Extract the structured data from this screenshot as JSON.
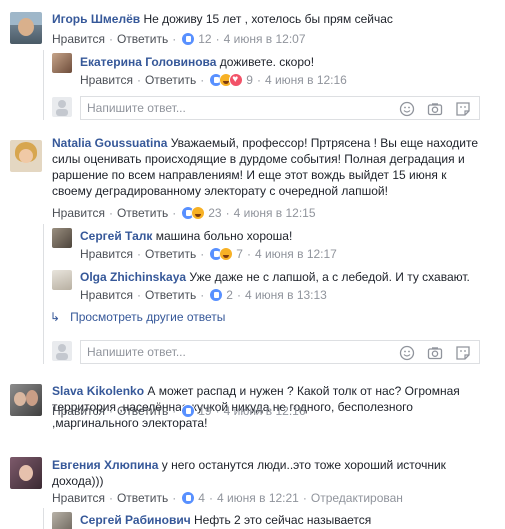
{
  "action_like": "Нравится",
  "action_reply": "Ответить",
  "action_dot": "·",
  "reply_placeholder": "Напишите ответ...",
  "view_more": "Просмотреть другие ответы",
  "comments": [
    {
      "author": "Игорь Шмелёв",
      "text": "Не доживу 15 лет , хотелось бы прям сейчас",
      "count": "12",
      "time": "4 июня в 12:07"
    },
    {
      "author": "Екатерина Головинова",
      "text": "доживете. скоро!",
      "count": "9",
      "time": "4 июня в 12:16"
    },
    {
      "author": "Natalia Goussuatina",
      "text": "Уважаемый, профессор! Прт",
      "text2": "рясена ! Вы еще находите",
      "line2": "силы оценивать происходящие в дурдоме события! Полная деградация и",
      "line3": "раршение по всем направлениям! И еще этот вождь выйдет 15 июня к",
      "line4": "своему деградированному электорату с очередной лапшой!",
      "count": "23",
      "time": "4 июня в 12:15"
    },
    {
      "author": "Сергей Талк",
      "text": "машина больно хороша!",
      "count": "7",
      "time": "4 июня в 12:17"
    },
    {
      "author": "Olga Zhichinskaya",
      "text": "Уже даже не с лапшой, а с лебедой. И ту схавают.",
      "count": "2",
      "time": "4 июня в 13:13"
    },
    {
      "author": "Slava Kikolenko",
      "text": "А может распад и нужен ? Какой толк от нас? Огромная",
      "line2": "территория ,населённая кучкой никуда не годного, бесполезного",
      "line3": ",маргинального электората!",
      "count": "19",
      "time": "4 июня в 12:16"
    },
    {
      "author": "Евгения Хлюпина",
      "text": "у него останутся люди..это тоже хороший источник",
      "line2": "дохода)))",
      "count": "4",
      "time": "4 июня в 12:21",
      "edited": "Отредактирован"
    },
    {
      "author": "Сергей Рабинович",
      "text": "Нефть 2 это сейчас называется"
    }
  ]
}
